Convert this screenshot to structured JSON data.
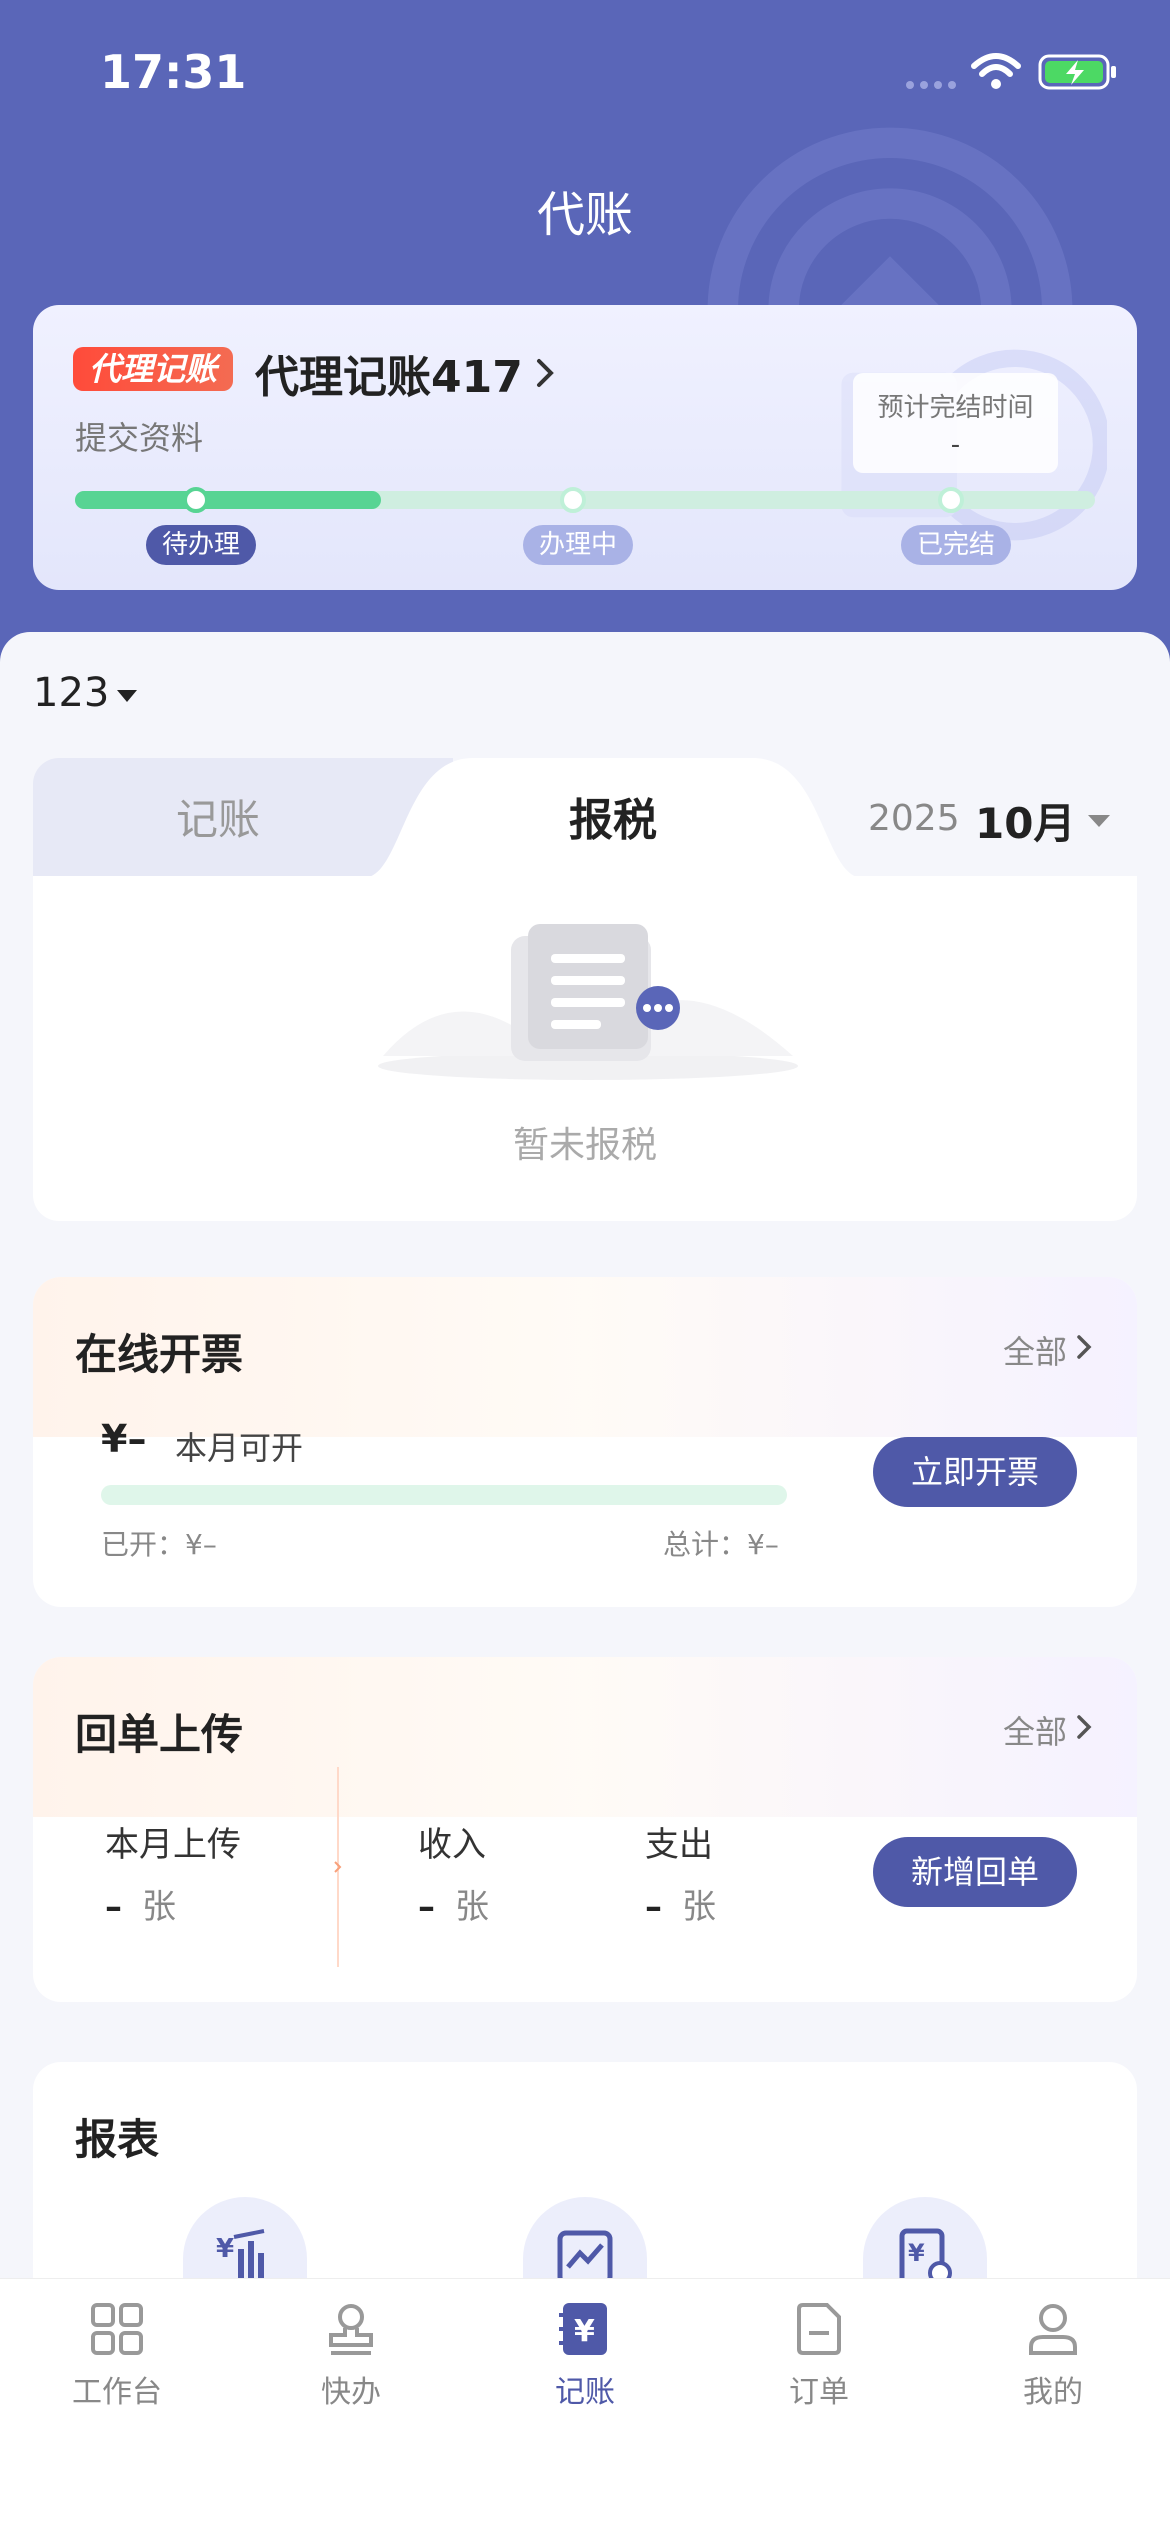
{
  "status_bar": {
    "time": "17:31"
  },
  "header": {
    "title": "代账"
  },
  "progress_card": {
    "badge": "代理记账",
    "title": "代理记账417",
    "subtitle": "提交资料",
    "eta_label": "预计完结时间",
    "eta_value": "-",
    "progress_fraction": 0.3,
    "steps": [
      {
        "label": "待办理",
        "active": true
      },
      {
        "label": "办理中",
        "active": false
      },
      {
        "label": "已完结",
        "active": false
      }
    ]
  },
  "company_selector": {
    "value": "123"
  },
  "record_tabs": {
    "tabs": [
      {
        "label": "记账"
      },
      {
        "label": "报税"
      }
    ],
    "active_index": 1,
    "year": "2025",
    "month": "10月",
    "empty_text": "暂未报税"
  },
  "invoice_card": {
    "title": "在线开票",
    "more": "全部",
    "amount": "¥–",
    "amount_label": "本月可开",
    "opened": "已开：¥–",
    "total": "总计：¥–",
    "progress_fraction": 0,
    "action": "立即开票"
  },
  "receipt_card": {
    "title": "回单上传",
    "more": "全部",
    "stats": [
      {
        "label": "本月上传",
        "value": "–",
        "unit": "张"
      },
      {
        "label": "收入",
        "value": "–",
        "unit": "张"
      },
      {
        "label": "支出",
        "value": "–",
        "unit": "张"
      }
    ],
    "action": "新增回单"
  },
  "report_card": {
    "title": "报表",
    "icons": [
      "income-chart-icon",
      "trend-report-icon",
      "expense-report-icon"
    ]
  },
  "tab_bar": {
    "items": [
      {
        "label": "工作台",
        "icon": "grid-icon",
        "active": false
      },
      {
        "label": "快办",
        "icon": "stamp-icon",
        "active": false
      },
      {
        "label": "记账",
        "icon": "ledger-icon",
        "active": true
      },
      {
        "label": "订单",
        "icon": "order-icon",
        "active": false
      },
      {
        "label": "我的",
        "icon": "user-icon",
        "active": false
      }
    ]
  },
  "colors": {
    "brand": "#5a66b8",
    "primary_button": "#4f59a8",
    "progress_green": "#57d493",
    "badge_red": "#ff4b3a"
  }
}
